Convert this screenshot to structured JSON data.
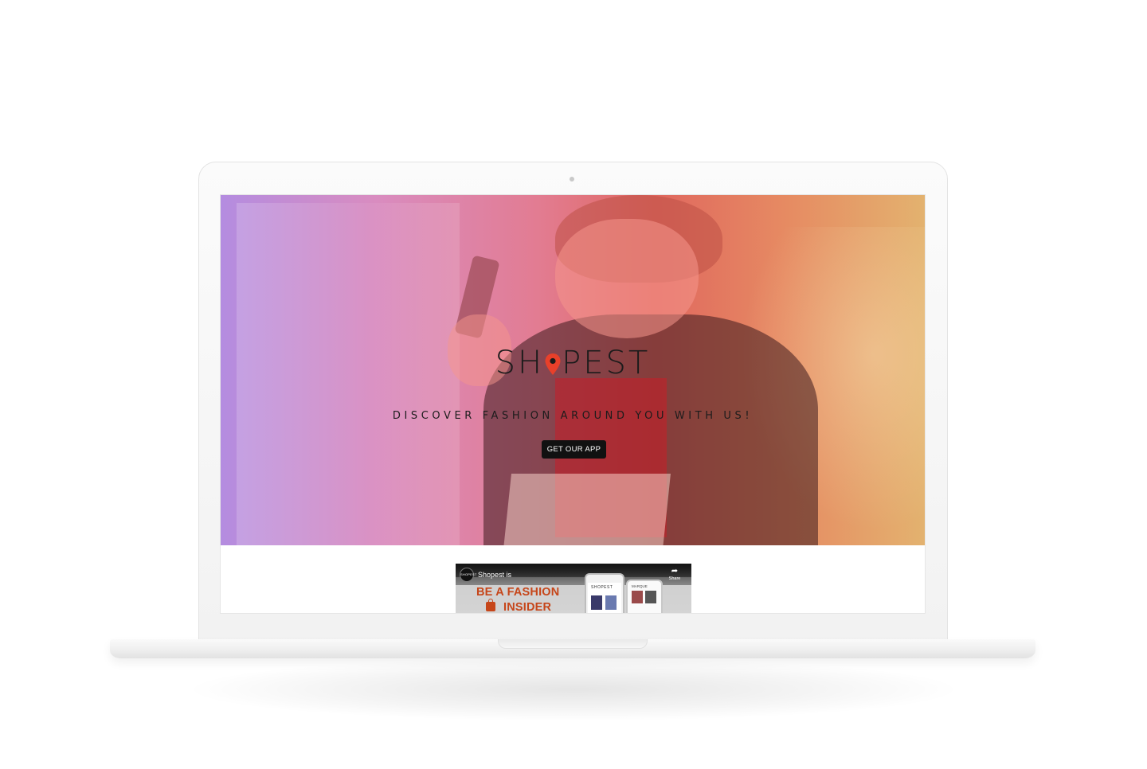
{
  "hero": {
    "brand": {
      "part_before_pin": "SH",
      "part_after_pin": "PEST",
      "full_name": "SHOPEST"
    },
    "tagline": "DISCOVER FASHION AROUND YOU WITH US!",
    "cta_label": "GET OUR APP",
    "pin_color": "#e8402a"
  },
  "video": {
    "channel_avatar_text": "SHOPEST",
    "title": "Shopest is",
    "share_label": "Share",
    "promo_line1": "BE A FASHION",
    "promo_line2": "INSIDER",
    "phone_logo": "SHOPEST",
    "phone_label": "MARQUE"
  },
  "colors": {
    "gradient_start": "#b48ce0",
    "gradient_mid": "#e0685f",
    "gradient_end": "#e3b26f",
    "promo_orange": "#c6461a",
    "button_bg": "#111111"
  }
}
